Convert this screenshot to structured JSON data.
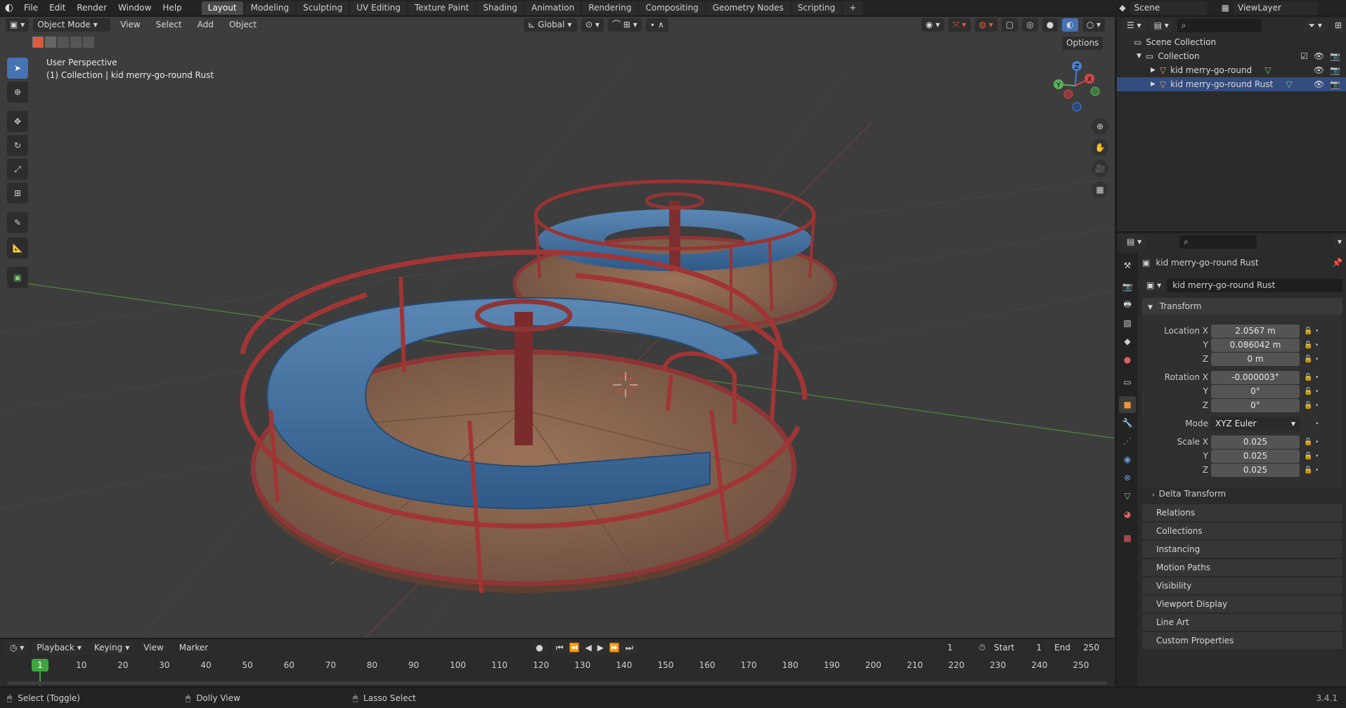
{
  "menu": [
    "File",
    "Edit",
    "Render",
    "Window",
    "Help"
  ],
  "workspaces": [
    "Layout",
    "Modeling",
    "Sculpting",
    "UV Editing",
    "Texture Paint",
    "Shading",
    "Animation",
    "Rendering",
    "Compositing",
    "Geometry Nodes",
    "Scripting"
  ],
  "scene_name": "Scene",
  "view_layer": "ViewLayer",
  "viewport": {
    "mode": "Object Mode",
    "menus": [
      "View",
      "Select",
      "Add",
      "Object"
    ],
    "orientation": "Global",
    "options": "Options",
    "overlay_title": "User Perspective",
    "overlay_subtitle": "(1) Collection | kid merry-go-round Rust",
    "gizmo": {
      "x": "X",
      "y": "Y",
      "z": "Z"
    }
  },
  "outliner": {
    "root": "Scene Collection",
    "collection": "Collection",
    "objects": [
      "kid merry-go-round",
      "kid merry-go-round Rust"
    ]
  },
  "properties": {
    "object_name": "kid merry-go-round Rust",
    "datablock": "kid merry-go-round Rust",
    "transform_title": "Transform",
    "location": {
      "label": "Location X",
      "x": "2.0567 m",
      "y": "0.086042 m",
      "z": "0 m"
    },
    "rotation": {
      "label": "Rotation X",
      "x": "-0.000003°",
      "y": "0°",
      "z": "0°"
    },
    "mode_label": "Mode",
    "mode_value": "XYZ Euler",
    "scale": {
      "label": "Scale X",
      "x": "0.025",
      "y": "0.025",
      "z": "0.025"
    },
    "axis_y": "Y",
    "axis_z": "Z",
    "delta": "Delta Transform",
    "panels": [
      "Relations",
      "Collections",
      "Instancing",
      "Motion Paths",
      "Visibility",
      "Viewport Display",
      "Line Art",
      "Custom Properties"
    ]
  },
  "timeline": {
    "playback": "Playback",
    "keying": "Keying",
    "view": "View",
    "marker": "Marker",
    "current_frame": "1",
    "start_label": "Start",
    "start": "1",
    "end_label": "End",
    "end": "250",
    "ticks": [
      "10",
      "20",
      "30",
      "40",
      "50",
      "60",
      "70",
      "80",
      "90",
      "100",
      "110",
      "120",
      "130",
      "140",
      "150",
      "160",
      "170",
      "180",
      "190",
      "200",
      "210",
      "220",
      "230",
      "240",
      "250"
    ],
    "playhead": "1"
  },
  "status": {
    "left": "Select (Toggle)",
    "middle": "Dolly View",
    "right": "Lasso Select",
    "version": "3.4.1"
  },
  "colors": {
    "accent": "#4772b3",
    "rust": "#9b2f2f",
    "seat": "#3f6f9e",
    "wood": "#8a6650",
    "playhead": "#3fa63f"
  }
}
